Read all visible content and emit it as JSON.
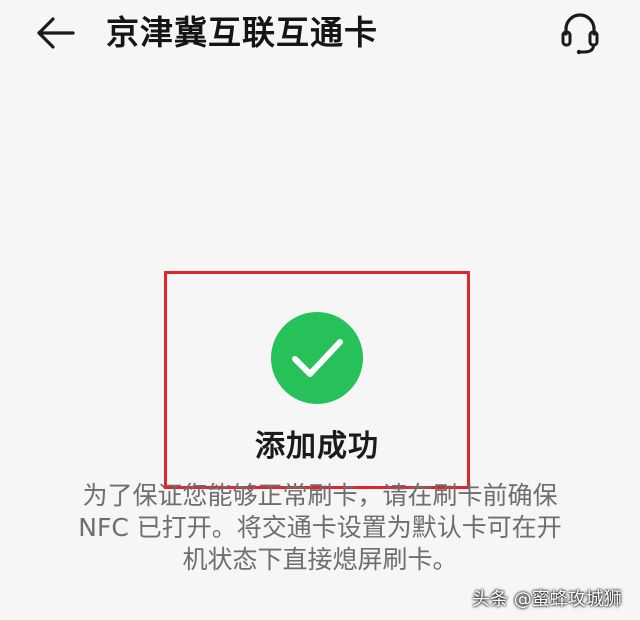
{
  "header": {
    "title": "京津冀互联互通卡",
    "back_icon": "arrow-left-icon",
    "support_icon": "headset-icon"
  },
  "status": {
    "icon": "check-circle-icon",
    "icon_color": "#27c15a",
    "title": "添加成功",
    "highlight_color": "#e0262b"
  },
  "description": {
    "line1": "为了保证您能够正常刷卡，请在刷卡前确保",
    "line2": "NFC 已打开。将交通卡设置为默认卡可在开",
    "line3": "机状态下直接熄屏刷卡。"
  },
  "watermark": {
    "text": "头条 @蜜蜂攻城狮"
  }
}
